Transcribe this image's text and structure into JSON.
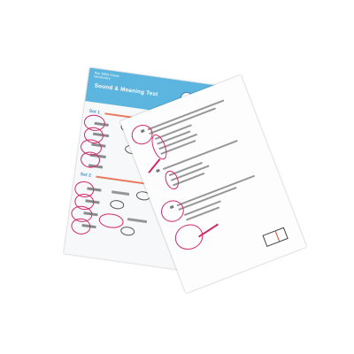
{
  "back_sheet": {
    "header_small_lines": [
      "Hoy SBAS Grade",
      "Vocabulary"
    ],
    "title": "Sound & Meaning Test",
    "set_labels": [
      "Set 1",
      "Set 2"
    ],
    "header_color": "#5cb5de",
    "title_color": "#ffffff",
    "set_label_color": "#3e9bd0",
    "instruction_color": "#e87b5f"
  },
  "front_sheet": {
    "question_count": 3
  },
  "marks": {
    "pen_color": "#d0296a"
  },
  "icons": [
    "logo-icon"
  ]
}
